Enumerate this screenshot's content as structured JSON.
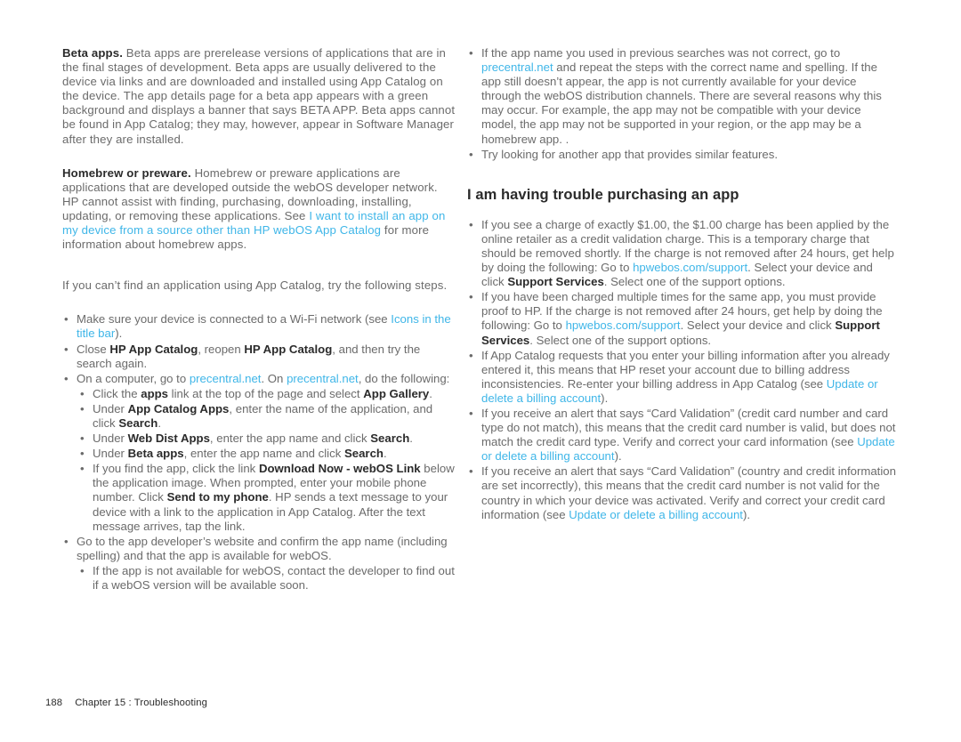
{
  "document": {
    "footer": {
      "page_number": "188",
      "chapter_label": "Chapter 15 : Troubleshooting"
    },
    "link_color": "#3fb6e8",
    "body_color": "#6b6b6b",
    "bold_color": "#2b2b2b"
  },
  "left_column": {
    "para_beta": {
      "lead": "Beta apps.",
      "body": " Beta apps are prerelease versions of applications that are in the final stages of development. Beta apps are usually delivered to the device via links and are downloaded and installed using App Catalog on the device. The app details page for a beta app appears with a green background and displays a banner that says BETA APP. Beta apps cannot be found in App Catalog; they may, however, appear in Software Manager after they are installed."
    },
    "para_homebrew": {
      "lead": "Homebrew or preware.",
      "body_1": " Homebrew or preware applications are applications that are developed outside the webOS developer network. HP cannot assist with finding, purchasing, downloading, installing, updating, or removing these applications. See ",
      "link_1": "I want to install an app on my device from a source other than HP webOS App Catalog",
      "body_2": " for more information about homebrew apps."
    },
    "para_intro": "If you can’t find an application using App Catalog, try the following steps.",
    "bullets": [
      {
        "seg": [
          {
            "t": "Make sure your device is connected to a Wi-Fi network (see ",
            "s": "n"
          },
          {
            "t": "Icons in the title bar",
            "s": "l"
          },
          {
            "t": ").",
            "s": "n"
          }
        ]
      },
      {
        "seg": [
          {
            "t": "Close ",
            "s": "n"
          },
          {
            "t": "HP App Catalog",
            "s": "b"
          },
          {
            "t": ", reopen ",
            "s": "n"
          },
          {
            "t": "HP App Catalog",
            "s": "b"
          },
          {
            "t": ", and then try the search again.",
            "s": "n"
          }
        ]
      },
      {
        "seg": [
          {
            "t": "On a computer, go to ",
            "s": "n"
          },
          {
            "t": "precentral.net",
            "s": "l"
          },
          {
            "t": ". On ",
            "s": "n"
          },
          {
            "t": "precentral.net",
            "s": "l"
          },
          {
            "t": ", do the following:",
            "s": "n"
          }
        ],
        "children": [
          {
            "seg": [
              {
                "t": "Click the ",
                "s": "n"
              },
              {
                "t": "apps",
                "s": "b"
              },
              {
                "t": " link at the top of the page and select ",
                "s": "n"
              },
              {
                "t": "App Gallery",
                "s": "b"
              },
              {
                "t": ".",
                "s": "n"
              }
            ]
          },
          {
            "seg": [
              {
                "t": "Under ",
                "s": "n"
              },
              {
                "t": "App Catalog Apps",
                "s": "b"
              },
              {
                "t": ", enter the name of the application, and click ",
                "s": "n"
              },
              {
                "t": "Search",
                "s": "b"
              },
              {
                "t": ".",
                "s": "n"
              }
            ]
          },
          {
            "seg": [
              {
                "t": "Under ",
                "s": "n"
              },
              {
                "t": "Web Dist Apps",
                "s": "b"
              },
              {
                "t": ", enter the app name and click ",
                "s": "n"
              },
              {
                "t": "Search",
                "s": "b"
              },
              {
                "t": ".",
                "s": "n"
              }
            ]
          },
          {
            "seg": [
              {
                "t": "Under ",
                "s": "n"
              },
              {
                "t": "Beta apps",
                "s": "b"
              },
              {
                "t": ", enter the app name and click ",
                "s": "n"
              },
              {
                "t": "Search",
                "s": "b"
              },
              {
                "t": ".",
                "s": "n"
              }
            ]
          },
          {
            "seg": [
              {
                "t": "If you find the app, click the link ",
                "s": "n"
              },
              {
                "t": "Download Now - webOS Link",
                "s": "b"
              },
              {
                "t": " below the application image. When prompted, enter your mobile phone number. Click ",
                "s": "n"
              },
              {
                "t": "Send to my phone",
                "s": "b"
              },
              {
                "t": ". HP sends a text message to your device with a link to the application in App Catalog. After the text message arrives, tap the link.",
                "s": "n"
              }
            ]
          }
        ]
      },
      {
        "seg": [
          {
            "t": "Go to the app developer’s website and confirm the app name (including spelling) and that the app is available for webOS.",
            "s": "n"
          }
        ],
        "children": [
          {
            "seg": [
              {
                "t": "If the app is not available for webOS, contact the developer to find out if a webOS version will be available soon.",
                "s": "n"
              }
            ]
          }
        ]
      }
    ]
  },
  "right_column": {
    "top_bullets": [
      {
        "seg": [
          {
            "t": "If the app name you used in previous searches was not correct, go to ",
            "s": "n"
          },
          {
            "t": "precentral.net",
            "s": "l"
          },
          {
            "t": " and repeat the steps with the correct name and spelling. If the app still doesn’t appear, the app is not currently available for your device through the webOS distribution channels. There are several reasons why this may occur. For example, the app may not be compatible with your device model, the app may not be supported in your region, or the app may be a homebrew app. .",
            "s": "n"
          }
        ]
      },
      {
        "seg": [
          {
            "t": "Try looking for another app that provides similar features.",
            "s": "n"
          }
        ]
      }
    ],
    "heading": "I am having trouble purchasing an app",
    "bullets": [
      {
        "seg": [
          {
            "t": " If you see a charge of exactly $1.00, the $1.00 charge has been applied by the online retailer as a credit validation charge. This is a temporary charge that should be removed shortly. If the charge is not removed after 24 hours, get help by doing the following: Go to ",
            "s": "n"
          },
          {
            "t": "hpwebos.com/support",
            "s": "l"
          },
          {
            "t": ". Select your device and click ",
            "s": "n"
          },
          {
            "t": "Support Services",
            "s": "b"
          },
          {
            "t": ". Select one of the support options.",
            "s": "n"
          }
        ]
      },
      {
        "seg": [
          {
            "t": "If you have been charged multiple times for the same app, you must provide proof to HP. If the charge is not removed after 24 hours, get help by doing the following: Go to ",
            "s": "n"
          },
          {
            "t": "hpwebos.com/support",
            "s": "l"
          },
          {
            "t": ". Select your device and click ",
            "s": "n"
          },
          {
            "t": "Support Services",
            "s": "b"
          },
          {
            "t": ". Select one of the support options.",
            "s": "n"
          }
        ]
      },
      {
        "seg": [
          {
            "t": "If App Catalog requests that you enter your billing information after you already entered it, this means that HP reset your account due to billing address inconsistencies. Re-enter your billing address in App Catalog (see ",
            "s": "n"
          },
          {
            "t": "Update or delete a billing account",
            "s": "l"
          },
          {
            "t": ").",
            "s": "n"
          }
        ]
      },
      {
        "seg": [
          {
            "t": "If you receive an alert that says “Card Validation” (credit card number and card type do not match), this means that the credit card number is valid, but does not match the credit card type. Verify and correct your card information (see ",
            "s": "n"
          },
          {
            "t": "Update or delete a billing account",
            "s": "l"
          },
          {
            "t": ").",
            "s": "n"
          }
        ]
      },
      {
        "seg": [
          {
            "t": "If you receive an alert that says “Card Validation” (country and credit information are set incorrectly), this means that the credit card number is not valid for the country in which your device was activated. Verify and correct your credit card information (see ",
            "s": "n"
          },
          {
            "t": "Update or delete a billing account",
            "s": "l"
          },
          {
            "t": ").",
            "s": "n"
          }
        ]
      }
    ]
  }
}
